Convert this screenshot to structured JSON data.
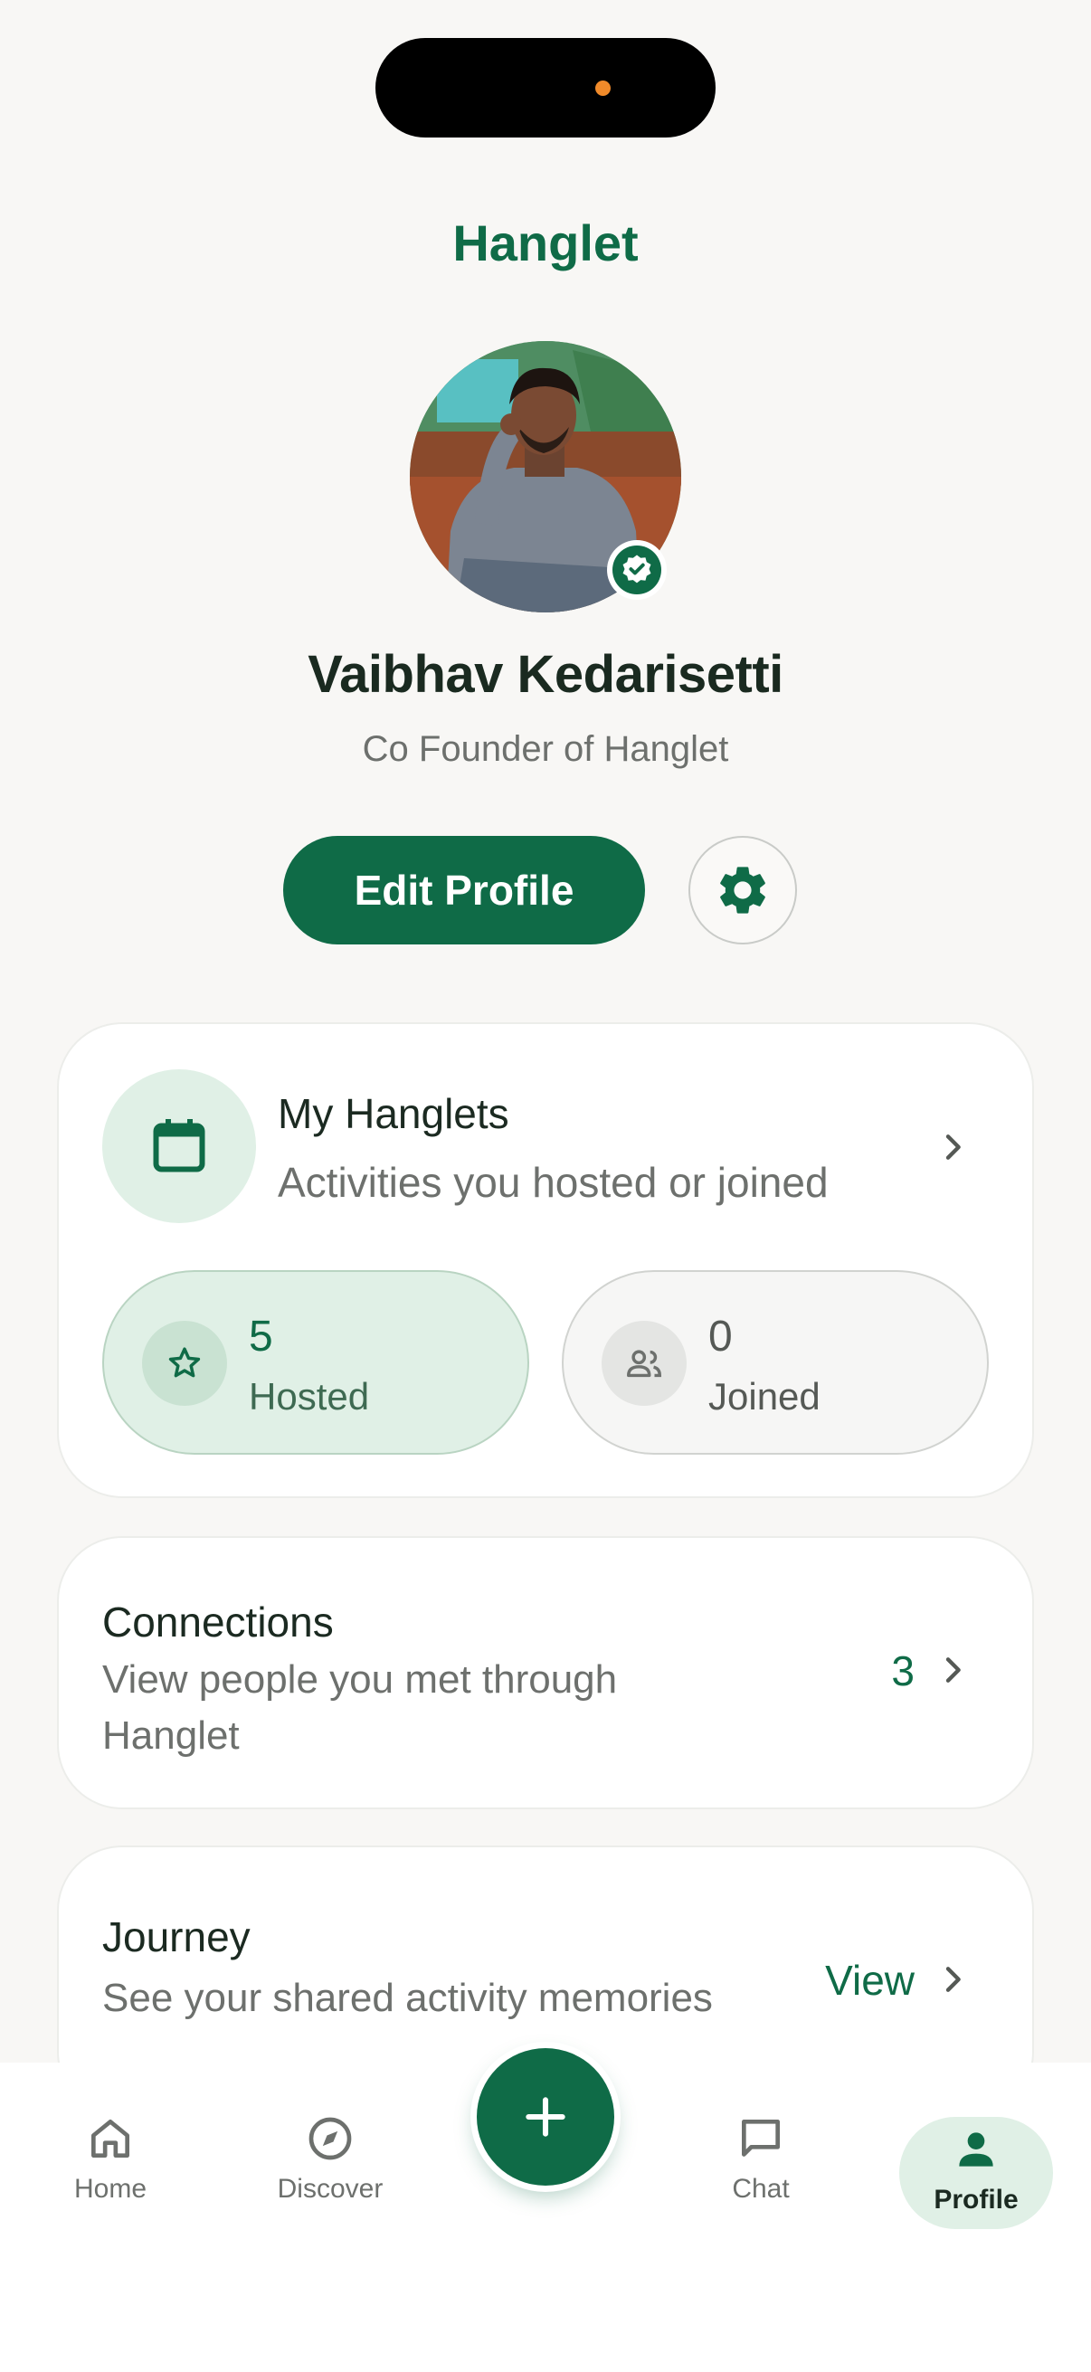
{
  "header": {
    "app_title": "Hanglet"
  },
  "profile": {
    "name": "Vaibhav Kedarisetti",
    "bio": "Co Founder of Hanglet",
    "edit_label": "Edit Profile"
  },
  "my_hanglets": {
    "title": "My Hanglets",
    "subtitle": "Activities you hosted or joined",
    "hosted": {
      "value": "5",
      "label": "Hosted"
    },
    "joined": {
      "value": "0",
      "label": "Joined"
    }
  },
  "connections": {
    "title": "Connections",
    "subtitle": "View people you met through Hanglet",
    "count": "3"
  },
  "journey": {
    "title": "Journey",
    "subtitle": "See your shared activity memories",
    "action": "View"
  },
  "nav": {
    "items": [
      {
        "label": "Home",
        "icon": "home-icon"
      },
      {
        "label": "Discover",
        "icon": "compass-icon"
      },
      {
        "label": "Chat",
        "icon": "chat-icon"
      },
      {
        "label": "Profile",
        "icon": "person-icon",
        "active": true
      }
    ],
    "fab_icon": "plus-icon"
  },
  "colors": {
    "brand": "#0f6b47",
    "accent_light": "#e0f0e6",
    "background": "#f8f7f5"
  }
}
